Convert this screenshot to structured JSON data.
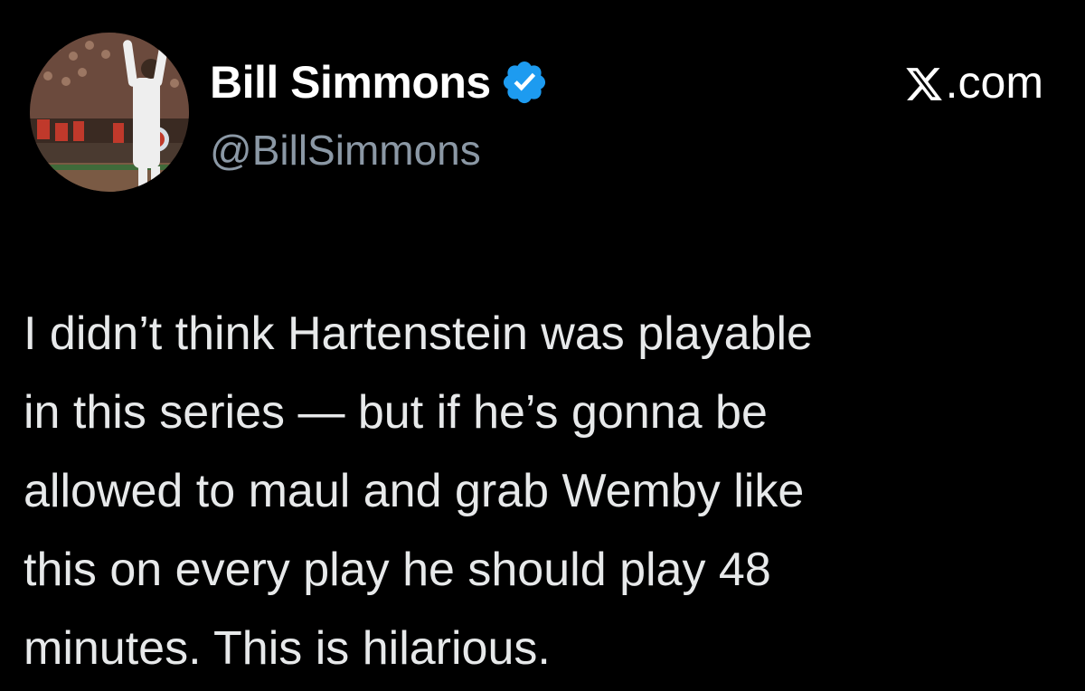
{
  "author": {
    "display_name": "Bill Simmons",
    "handle": "@BillSimmons",
    "verified": true
  },
  "site": {
    "label": ".com",
    "logo_icon": "x-logo-icon"
  },
  "tweet": {
    "lines": [
      "I didn’t think Hartenstein was playable",
      "in this series — but if he’s gonna be",
      "allowed to maul and grab Wemby like",
      "this on every play he should play 48",
      "minutes. This is hilarious."
    ]
  },
  "colors": {
    "background": "#000000",
    "text": "#e7e9ea",
    "name": "#ffffff",
    "handle": "#8b98a5",
    "verified": "#1d9bf0"
  }
}
